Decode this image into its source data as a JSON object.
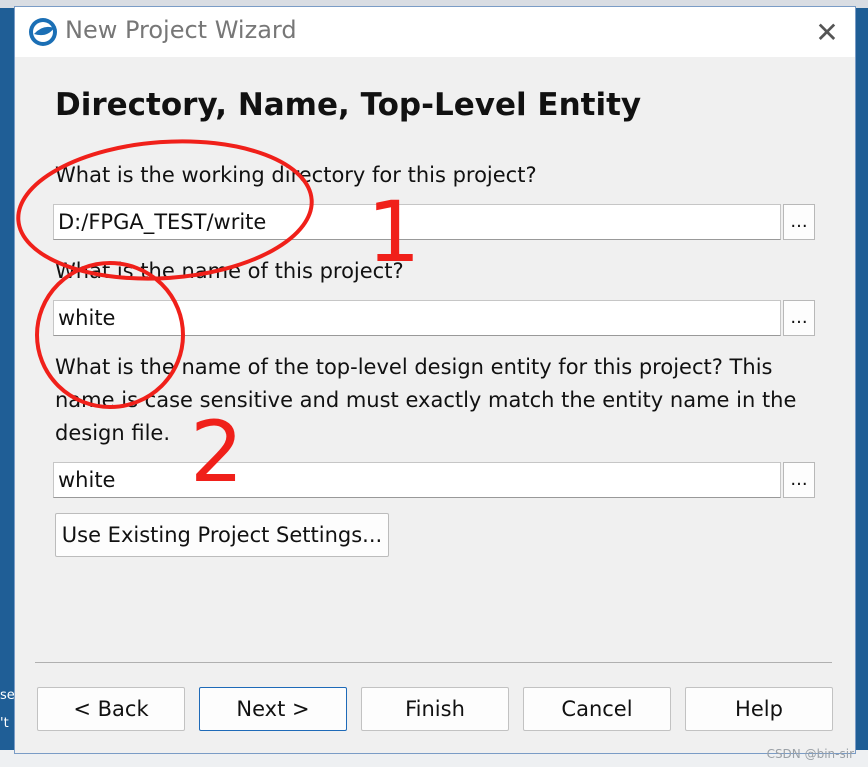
{
  "window": {
    "title": "New Project Wizard",
    "close_glyph": "✕"
  },
  "page": {
    "heading": "Directory, Name, Top-Level Entity"
  },
  "fields": {
    "directory_label": "What is the working directory for this project?",
    "directory_value": "D:/FPGA_TEST/write",
    "name_label": "What is the name of this project?",
    "name_value": "white",
    "entity_label": "What is the name of the top-level design entity for this project? This name is case sensitive and must exactly match the entity name in the design file.",
    "entity_value": "white",
    "browse_label": "..."
  },
  "buttons": {
    "use_existing": "Use Existing Project Settings...",
    "back": "< Back",
    "next": "Next >",
    "finish": "Finish",
    "cancel": "Cancel",
    "help": "Help"
  },
  "annotations": {
    "number_1": "1",
    "number_2": "2",
    "color": "#f0201a"
  },
  "background": {
    "left_text_1": "se",
    "left_text_2": "'t",
    "watermark": "CSDN @bin-sir"
  },
  "icons": {
    "app": "quartus-globe-icon",
    "close": "close-icon"
  }
}
